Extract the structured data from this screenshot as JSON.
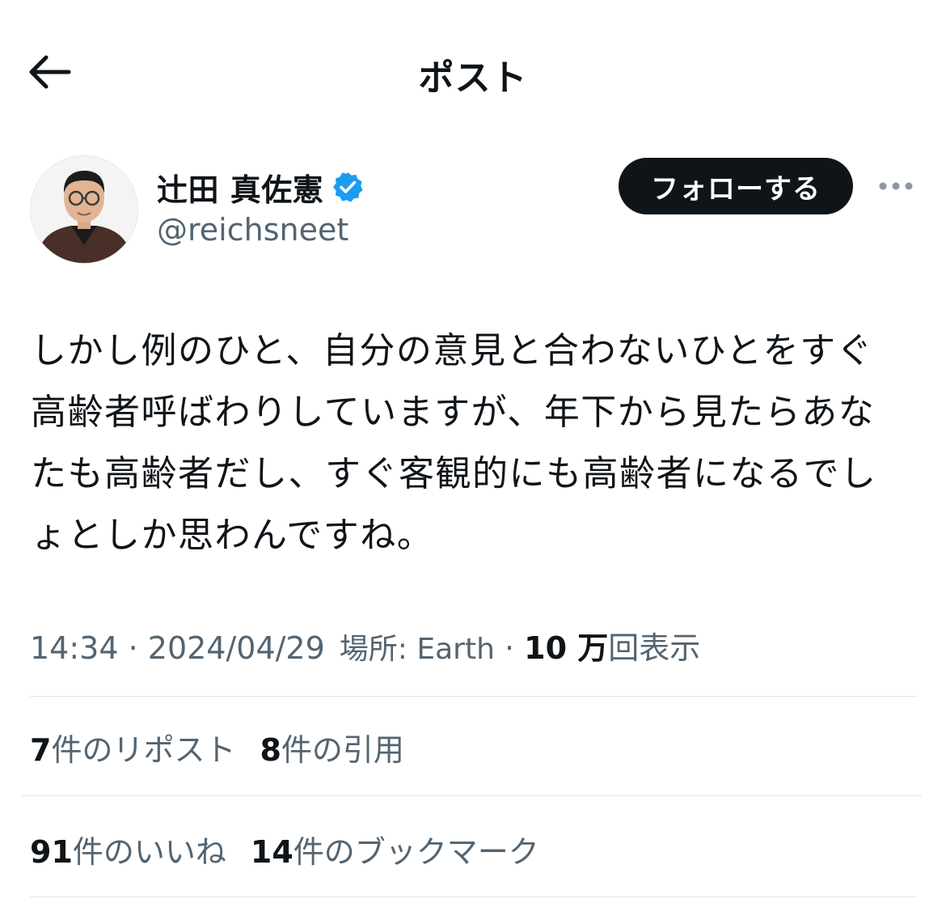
{
  "header": {
    "title": "ポスト"
  },
  "author": {
    "display_name": "辻田 真佐憲",
    "handle": "@reichsneet",
    "verified": true,
    "avatar": "avatar-photo"
  },
  "follow_button": {
    "label": "フォローする"
  },
  "post": {
    "lines": [
      "しかし例のひと、自分の意見と合わないひとをすぐ",
      "高齢者呼ばわりしていますが、年下から見たらあな",
      "たも高齢者だし、すぐ客観的にも高齢者になるでし",
      "ょとしか思わんですね。"
    ]
  },
  "meta": {
    "time": "14:34",
    "sep1": " · ",
    "date": "2024/04/29",
    "location": "場所: Earth",
    "sep2": " · ",
    "views_count": "10 万",
    "views_label": "回表示"
  },
  "stats_row1": [
    {
      "count": "7",
      "label": "件のリポスト"
    },
    {
      "count": "8",
      "label": "件の引用"
    }
  ],
  "stats_row2": [
    {
      "count": "91",
      "label": "件のいいね"
    },
    {
      "count": "14",
      "label": "件のブックマーク"
    }
  ],
  "icons": {
    "back": "back-arrow-icon",
    "more": "more-options-icon",
    "verified": "verified-badge-icon"
  },
  "colors": {
    "verified": "#1d9bf0",
    "secondary_text": "#536471",
    "primary_text": "#0f1419"
  }
}
